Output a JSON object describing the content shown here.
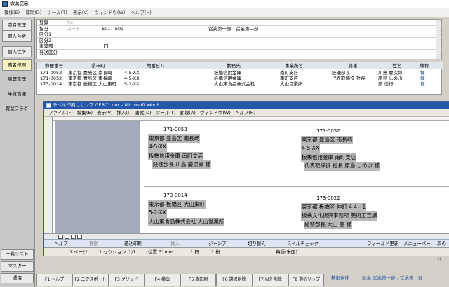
{
  "app": {
    "title": "宛名印刷"
  },
  "menu": [
    "操作(E)",
    "補助(D)",
    "ツール(T)",
    "表示(V)",
    "ウィンドウ(W)",
    "ヘルプ(H)"
  ],
  "nav": {
    "items": [
      {
        "label": "宛名管理"
      },
      {
        "label": "個人台帳"
      },
      {
        "label": "個人住所"
      },
      {
        "label": "宛名印刷"
      },
      {
        "label": "履歴管理"
      },
      {
        "label": "年賀管理"
      },
      {
        "label": "賀状フラグ"
      }
    ],
    "bottom": [
      "一覧リスト",
      "マスター",
      "運用"
    ]
  },
  "form": {
    "rows": [
      {
        "label": "登録",
        "sub": "No",
        "value": "",
        "value2": ""
      },
      {
        "label": "担当",
        "sub": "コード",
        "value": "E01 - E02",
        "value2": "営業第一部 - 営業第二部"
      },
      {
        "label": "区分1",
        "sub": "",
        "value": "",
        "value2": ""
      },
      {
        "label": "区分2",
        "sub": "",
        "value": "",
        "value2": ""
      },
      {
        "label": "事業部",
        "sub": "",
        "value": "",
        "value2": ""
      },
      {
        "label": "発送区分",
        "sub": "",
        "value": "",
        "value2": ""
      }
    ]
  },
  "table": {
    "headers": [
      "郵便番号",
      "県市町",
      "地番ビル",
      "勤務先",
      "事業所名",
      "肩書",
      "姓名",
      "敬称"
    ],
    "rows": [
      [
        "171-0052",
        "東京都 豊島区 南長崎",
        "4-5-XX",
        "板橋信用金庫",
        "南町支店",
        "経理部長",
        "川島 慶次郎",
        "様"
      ],
      [
        "171-0052",
        "東京都 豊島区 南長崎",
        "4-5-XX",
        "板橋信用金庫",
        "南町支店",
        "代表取締役 社長",
        "原島 しのぶ",
        "様"
      ],
      [
        "173-0014",
        "東京都 板橋区 大山東町",
        "5-2-XX",
        "大山東食品株式会社",
        "大山営業所",
        "",
        "斎 信行",
        "様"
      ]
    ]
  },
  "word": {
    "title": "ラベル印刷にサンプ GEB01.doc - Microsoft Word",
    "menu": [
      "ファイル(F)",
      "編集(E)",
      "表示(V)",
      "挿入(I)",
      "書式(O)",
      "ツール(T)",
      "罫線(A)",
      "ウィンドウ(W)",
      "ヘルプ(H)"
    ],
    "labels": [
      {
        "zip": "171-0052",
        "line1": "東京都 豊島区 南長崎",
        "line2": "4-5-XX",
        "line3": "板橋信用金庫 南町支店",
        "line4": "経理部長 川島 慶次郎 様"
      },
      {
        "zip": "171-0052",
        "line1": "東京都 豊島区 南長崎",
        "line2": "4-5-XX",
        "line3": "板橋信用金庫 南町支店",
        "line4": "代表取締役 社長 原島 しのぶ 様"
      },
      {
        "zip": "173-0014",
        "line1": "東京都 板橋区 大山東町",
        "line2": "5-2-XX",
        "line3": "大山東食品株式会社 大山営業所",
        "line4": ""
      },
      {
        "zip": "173-0022",
        "line1": "東京都 板橋区 仲町 4 4 - 1",
        "line2": "",
        "line3": "板橋文化振興事務所 美術工芸課",
        "line4": "総務部長 大山 登 様"
      }
    ],
    "merge": [
      "ヘルプ",
      "移動",
      "差込印刷",
      "挿入",
      "ジャンプ",
      "切り替え",
      "スペルチェック",
      "フィールド更新",
      "メニューバー",
      "次のページ"
    ],
    "status": {
      "page": "1 ページ",
      "section": "1 セクション",
      "pages": "1/1",
      "pos": "位置 31mm",
      "line": "1 行",
      "col": "1 桁",
      "lang": "英語(米国)"
    }
  },
  "fkeys": [
    "F1 ヘルプ",
    "F2 エクスポート",
    "F3 グリッド",
    "F4 検出",
    "F5 表印刷",
    "F6 選択削除",
    "F7 以外削除",
    "F8 選択リップ"
  ],
  "bottom_status": {
    "left": "検出条件",
    "right": "担当 営業第一部 - 営業第二部"
  }
}
